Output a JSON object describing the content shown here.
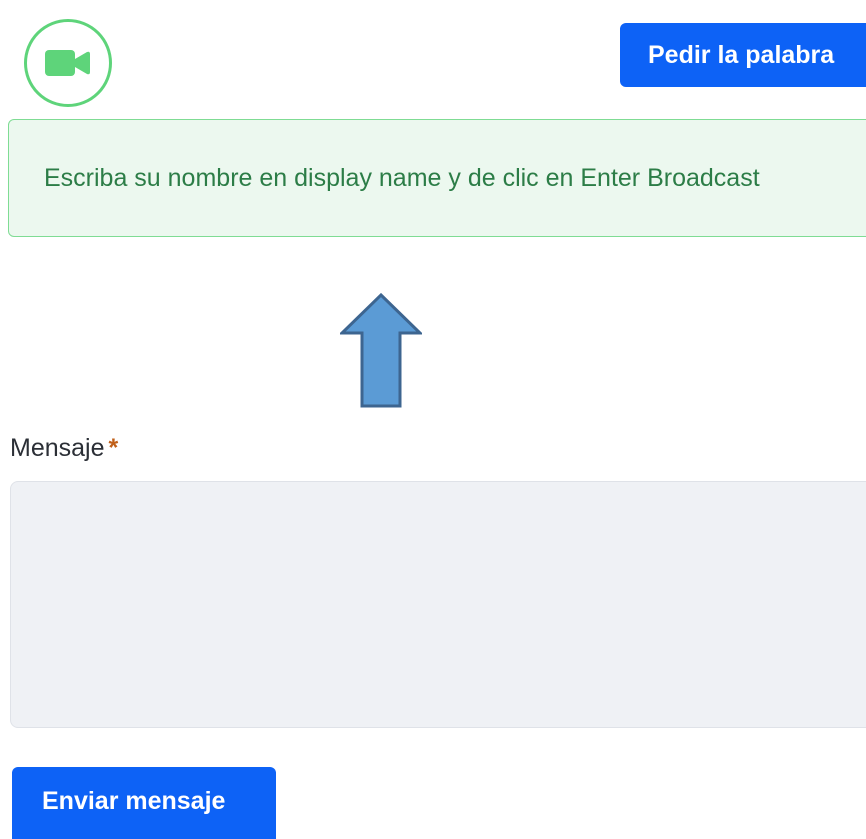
{
  "header": {
    "video_icon": "video-camera-icon",
    "request_floor_label": "Pedir la palabra"
  },
  "alert": {
    "text": "Escriba su nombre en display name y de clic en Enter Broadcast"
  },
  "annotation": {
    "arrow_icon": "up-arrow-icon"
  },
  "form": {
    "message_label": "Mensaje",
    "required_marker": "*",
    "message_value": "",
    "send_label": "Enviar mensaje"
  },
  "colors": {
    "primary": "#0d62f6",
    "success_border": "#5ed47a",
    "alert_bg": "#ecf8ef",
    "alert_text": "#2c7d47",
    "arrow_fill": "#5b9bd5",
    "arrow_stroke": "#3d6590",
    "required": "#c0601a"
  }
}
